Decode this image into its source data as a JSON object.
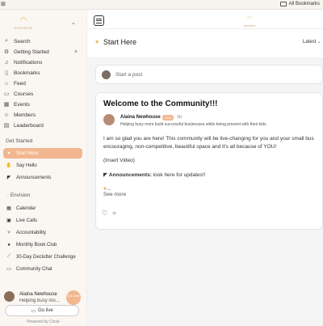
{
  "browser": {
    "bookmarks_label": "All Bookmarks"
  },
  "sidebar": {
    "logo_text": "ENVISION",
    "nav": [
      {
        "label": "Search",
        "icon": "search-icon"
      },
      {
        "label": "Getting Started",
        "icon": "settings-icon"
      },
      {
        "label": "Notifications",
        "icon": "bell-icon"
      },
      {
        "label": "Bookmarks",
        "icon": "bookmark-icon"
      },
      {
        "label": "Feed",
        "icon": "home-icon"
      },
      {
        "label": "Courses",
        "icon": "course-icon"
      },
      {
        "label": "Events",
        "icon": "calendar-icon"
      },
      {
        "label": "Members",
        "icon": "members-icon"
      },
      {
        "label": "Leaderboard",
        "icon": "chart-icon"
      }
    ],
    "get_started_label": "Get Started",
    "get_started_items": [
      {
        "label": "Start Here",
        "icon": "heart-icon",
        "active": true
      },
      {
        "label": "Say Hello",
        "icon": "wave-icon",
        "active": false
      },
      {
        "label": "Announcements",
        "icon": "megaphone-icon",
        "active": false
      }
    ],
    "envision_label": "Envision",
    "envision_items": [
      {
        "label": "Calendar",
        "icon": "calendar-icon"
      },
      {
        "label": "Live Calls",
        "icon": "live-icon"
      },
      {
        "label": "Accountability",
        "icon": "handshake-icon"
      },
      {
        "label": "Monthly Book Club",
        "icon": "book-icon"
      },
      {
        "label": "30-Day Declutter Challenge",
        "icon": "broom-icon"
      },
      {
        "label": "Community Chat",
        "icon": "chat-icon"
      }
    ],
    "user": {
      "name": "Alaina Newhouse",
      "subtitle": "Helping busy mo...",
      "go_live_badge": "Go Live"
    },
    "go_live_button": "Go live",
    "powered_by": "Powered by Circle"
  },
  "main": {
    "page_title": "Start Here",
    "sort_label": "Latest",
    "post_placeholder": "Start a post",
    "post": {
      "title": "Welcome to the Community!!!",
      "author": "Alaina Newhouse",
      "badge": "Host",
      "time": "1h",
      "bio": "Helping busy mom build successful businesses while being present with their kids",
      "para1_line1": "I am so glad you are here! This community will be live-changing for you and your small bus",
      "para1_line2": "encouraging, non-competitive, beautiful space and it's all because of YOU!",
      "para2": "(Insert Video)",
      "announce_bold": "Announcements:",
      "announce_rest": " look here for updates!!",
      "trail": "...",
      "see_more": "See more"
    }
  },
  "colors": {
    "accent": "#f2b78f",
    "logo": "#e8b04a"
  }
}
